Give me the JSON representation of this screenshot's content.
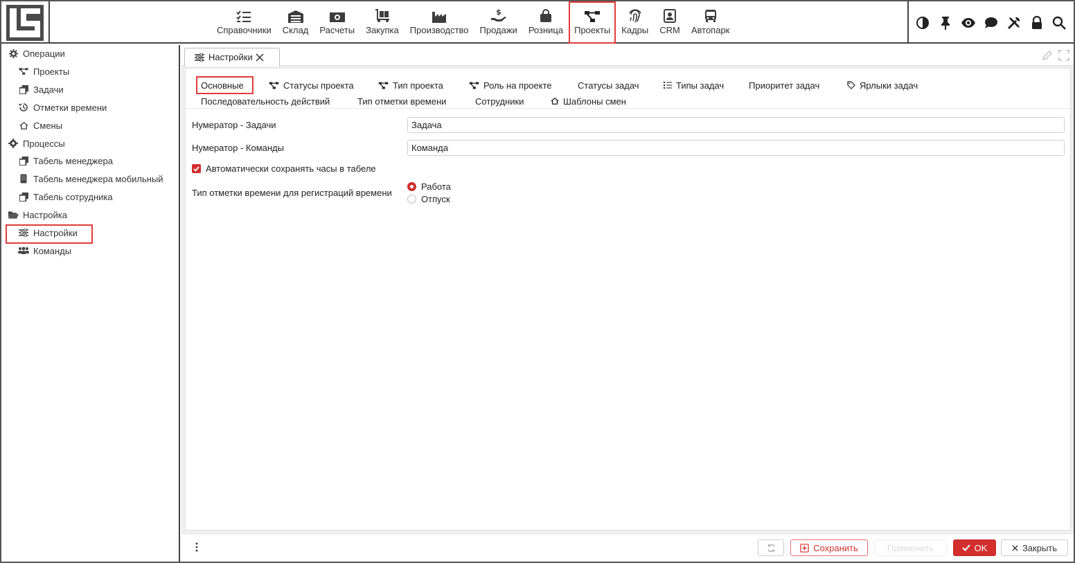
{
  "modules": [
    {
      "label": "Справочники",
      "icon": "list-check-icon"
    },
    {
      "label": "Склад",
      "icon": "warehouse-icon"
    },
    {
      "label": "Расчеты",
      "icon": "money-icon"
    },
    {
      "label": "Закупка",
      "icon": "dolly-icon"
    },
    {
      "label": "Производство",
      "icon": "factory-icon"
    },
    {
      "label": "Продажи",
      "icon": "hand-dollar-icon"
    },
    {
      "label": "Розница",
      "icon": "shopping-bag-icon"
    },
    {
      "label": "Проекты",
      "icon": "project-diagram-icon",
      "active": true
    },
    {
      "label": "Кадры",
      "icon": "fingerprint-icon"
    },
    {
      "label": "CRM",
      "icon": "contact-card-icon"
    },
    {
      "label": "Автопарк",
      "icon": "bus-icon"
    }
  ],
  "toolbar_icons": [
    "contrast-icon",
    "pin-icon",
    "eye-icon",
    "comment-icon",
    "tools-icon",
    "lock-icon",
    "search-icon"
  ],
  "sidebar": {
    "groups": [
      {
        "label": "Операции",
        "icon": "gear-icon",
        "items": [
          {
            "label": "Проекты",
            "icon": "project-diagram-icon"
          },
          {
            "label": "Задачи",
            "icon": "clone-icon"
          },
          {
            "label": "Отметки времени",
            "icon": "history-icon"
          },
          {
            "label": "Смены",
            "icon": "home-outline-icon"
          }
        ]
      },
      {
        "label": "Процессы",
        "icon": "cog-alt-icon",
        "items": [
          {
            "label": "Табель менеджера",
            "icon": "clone-icon"
          },
          {
            "label": "Табель менеджера мобильный",
            "icon": "mobile-icon"
          },
          {
            "label": "Табель сотрудника",
            "icon": "clone-icon"
          }
        ]
      },
      {
        "label": "Настройка",
        "icon": "folder-open-icon",
        "items": [
          {
            "label": "Настройки",
            "icon": "sliders-icon"
          },
          {
            "label": "Команды",
            "icon": "users-icon"
          }
        ]
      }
    ]
  },
  "document_tab": {
    "label": "Настройки"
  },
  "subtabs": [
    {
      "label": "Основные",
      "icon": "",
      "active": true
    },
    {
      "label": "Статусы проекта",
      "icon": "project-diagram-icon"
    },
    {
      "label": "Тип проекта",
      "icon": "project-diagram-icon"
    },
    {
      "label": "Роль на проекте",
      "icon": "project-diagram-icon"
    },
    {
      "label": "Статусы задач",
      "icon": ""
    },
    {
      "label": "Типы задач",
      "icon": "list-icon"
    },
    {
      "label": "Приоритет задач",
      "icon": ""
    },
    {
      "label": "Ярлыки задач",
      "icon": "tag-icon"
    },
    {
      "label": "Последовательность действий",
      "icon": ""
    },
    {
      "label": "Тип отметки времени",
      "icon": ""
    },
    {
      "label": "Сотрудники",
      "icon": ""
    },
    {
      "label": "Шаблоны смен",
      "icon": "home-outline-icon"
    }
  ],
  "form": {
    "task_numerator_label": "Нумератор - Задачи",
    "task_numerator_value": "Задача",
    "team_numerator_label": "Нумератор - Команды",
    "team_numerator_value": "Команда",
    "autosave_label": "Автоматически сохранять часы в табеле",
    "autosave_checked": true,
    "time_mark_type_label": "Тип отметки времени для регистраций времени",
    "time_mark_options": [
      "Работа",
      "Отпуск"
    ],
    "time_mark_selected": "Работа"
  },
  "footer": {
    "save_label": "Сохранить",
    "apply_label": "Применить",
    "ok_label": "OK",
    "close_label": "Закрыть"
  },
  "colors": {
    "accent": "#d32f2f",
    "highlight": "#e03b3b",
    "border": "#444444"
  }
}
